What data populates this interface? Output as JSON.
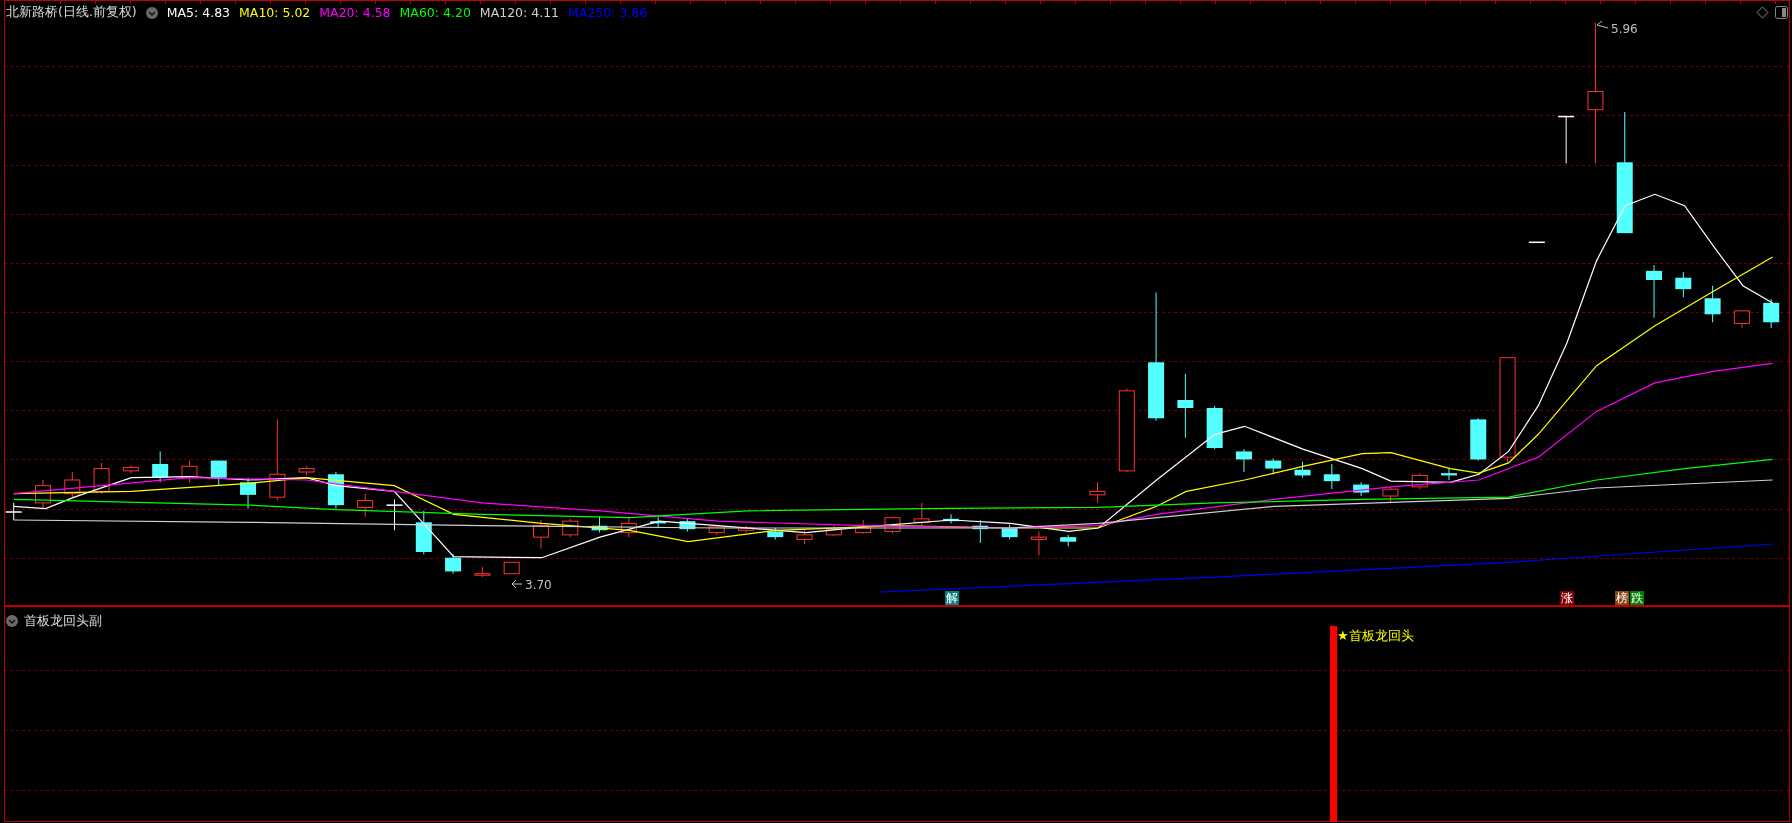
{
  "chart": {
    "title": "北新路桥(日线.前复权)",
    "indicators": [
      {
        "label": "MA5: 4.83",
        "color": "#ffffff"
      },
      {
        "label": "MA10: 5.02",
        "color": "#ffff00"
      },
      {
        "label": "MA20: 4.58",
        "color": "#ff00ff"
      },
      {
        "label": "MA60: 4.20",
        "color": "#00ff00"
      },
      {
        "label": "MA120: 4.11",
        "color": "#d0d0d0"
      },
      {
        "label": "MA250: 3.86",
        "color": "#0000ff"
      }
    ],
    "high_label": "5.96",
    "low_label": "3.70",
    "markers": [
      {
        "text": "解",
        "color": "#008080"
      },
      {
        "text": "涨",
        "color": "#800000"
      },
      {
        "text": "榜",
        "color": "#8b4513"
      },
      {
        "text": "跌",
        "color": "#008000"
      }
    ]
  },
  "sub_pane": {
    "title": "首板龙回头副",
    "signal_label": "★首板龙回头"
  }
}
